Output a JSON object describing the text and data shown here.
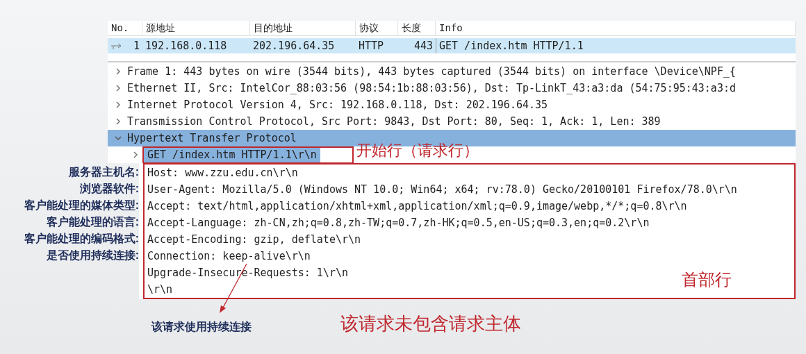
{
  "packet_list": {
    "columns": [
      "No.",
      "源地址",
      "目的地址",
      "协议",
      "长度",
      "Info"
    ],
    "rows": [
      {
        "cells": [
          "1",
          "192.168.0.118",
          "202.196.64.35",
          "HTTP",
          "443",
          "GET /index.htm HTTP/1.1"
        ],
        "selected": true
      }
    ]
  },
  "details": [
    {
      "label": "Frame 1: 443 bytes on wire (3544 bits), 443 bytes captured (3544 bits) on interface \\Device\\NPF_{",
      "expanded": false,
      "selected": false
    },
    {
      "label": "Ethernet II, Src: IntelCor_88:03:56 (98:54:1b:88:03:56), Dst: Tp-LinkT_43:a3:da (54:75:95:43:a3:d",
      "expanded": false,
      "selected": false
    },
    {
      "label": "Internet Protocol Version 4, Src: 192.168.0.118, Dst: 202.196.64.35",
      "expanded": false,
      "selected": false
    },
    {
      "label": "Transmission Control Protocol, Src Port: 9843, Dst Port: 80, Seq: 1, Ack: 1, Len: 389",
      "expanded": false,
      "selected": false
    },
    {
      "label": "Hypertext Transfer Protocol",
      "expanded": true,
      "selected": true,
      "children": [
        {
          "kind": "branch",
          "label": "GET /index.htm HTTP/1.1\\r\\n",
          "expanded": false,
          "selected": true
        },
        {
          "kind": "field",
          "label": "Host: www.zzu.edu.cn\\r\\n",
          "note": "服务器主机名:"
        },
        {
          "kind": "field",
          "label": "User-Agent: Mozilla/5.0 (Windows NT 10.0; Win64; x64; rv:78.0) Gecko/20100101 Firefox/78.0\\r\\n",
          "note": "浏览器软件:"
        },
        {
          "kind": "field",
          "label": "Accept: text/html,application/xhtml+xml,application/xml;q=0.9,image/webp,*/*;q=0.8\\r\\n",
          "note": "客户能处理的媒体类型:"
        },
        {
          "kind": "field",
          "label": "Accept-Language: zh-CN,zh;q=0.8,zh-TW;q=0.7,zh-HK;q=0.5,en-US;q=0.3,en;q=0.2\\r\\n",
          "note": "客户能处理的语言:"
        },
        {
          "kind": "field",
          "label": "Accept-Encoding: gzip, deflate\\r\\n",
          "note": "客户能处理的编码格式:"
        },
        {
          "kind": "field",
          "label": "Connection: keep-alive\\r\\n",
          "note": "是否使用持续连接:"
        },
        {
          "kind": "field",
          "label": "Upgrade-Insecure-Requests: 1\\r\\n"
        },
        {
          "kind": "field",
          "label": "\\r\\n"
        }
      ]
    }
  ],
  "annotations": {
    "request_line": "开始行（请求行）",
    "headers": "首部行",
    "arrow_note": "该请求使用持续连接",
    "body_note": "该请求未包含请求主体"
  }
}
